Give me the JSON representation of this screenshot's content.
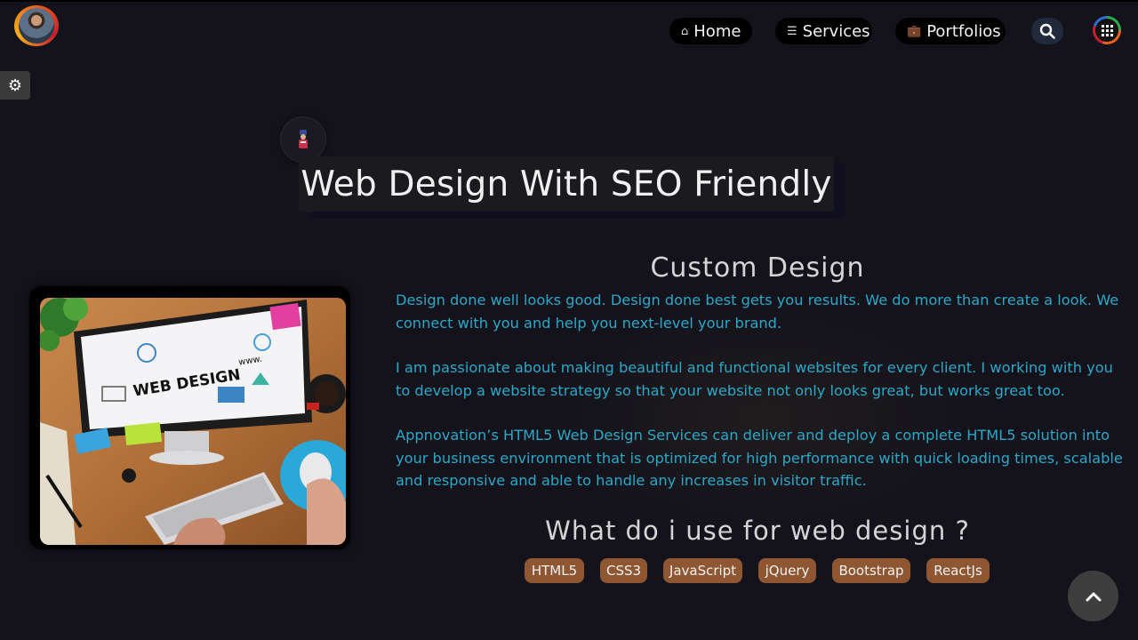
{
  "header": {
    "nav": [
      {
        "label": "Home",
        "icon": "home-icon"
      },
      {
        "label": "Services",
        "icon": "menu-icon"
      },
      {
        "label": "Portfolios",
        "icon": "briefcase-icon"
      }
    ],
    "search_icon": "search-icon",
    "apps_icon": "apps-grid-icon",
    "avatar": "profile-avatar"
  },
  "settings_icon": "gear-icon",
  "title": {
    "text": "Web Design With SEO Friendly",
    "icon": "designer-icon"
  },
  "image": {
    "screen_text": "WEB DESIGN",
    "screen_subtext": "www."
  },
  "content": {
    "heading": "Custom Design",
    "paragraphs": [
      "Design done well looks good. Design done best gets you results. We do more than create a look. We connect with you and help you next-level your brand.",
      "I am passionate about making beautiful and functional websites for every client. I working with you to develop a website strategy so that your website not only looks great, but works great too.",
      "Appnovation’s HTML5 Web Design Services can deliver and deploy a complete HTML5 solution into your business environment that is optimized for high performance with quick loading times, scalable and responsive and able to handle any increases in visitor traffic."
    ],
    "tools_heading": "What do i use for web design ?",
    "tools": [
      "HTML5",
      "CSS3",
      "JavaScript",
      "jQuery",
      "Bootstrap",
      "ReactJs"
    ]
  },
  "scroll_top_icon": "chevron-up-icon",
  "colors": {
    "background": "#14131c",
    "paragraph": "#2aa8c8",
    "tag": "#8e5631",
    "nav_button": "#000000"
  }
}
